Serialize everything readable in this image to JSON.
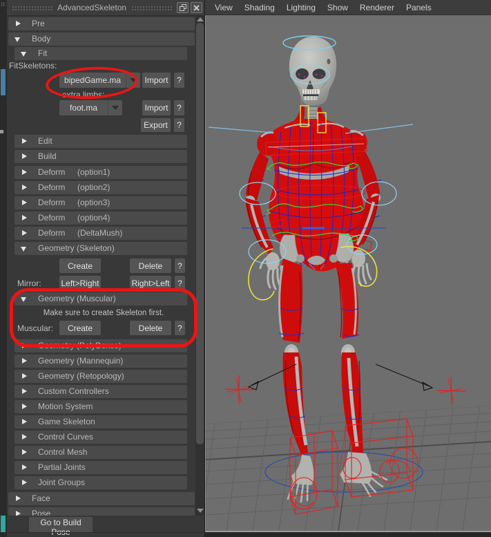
{
  "window": {
    "title": "AdvancedSkeleton"
  },
  "panel": {
    "help": "?",
    "sections": {
      "pre": "Pre",
      "body": "Body",
      "face": "Face",
      "pose": "Pose"
    },
    "fit": {
      "header": "Fit",
      "fitskeletons_label": "FitSkeletons:",
      "skeleton_file": "bipedGame.ma",
      "import_label": "Import",
      "extra_limbs_label": "extra limbs:",
      "limb_file": "foot.ma",
      "export_label": "Export"
    },
    "rows": [
      {
        "label": "Edit",
        "option": ""
      },
      {
        "label": "Build",
        "option": ""
      },
      {
        "label": "Deform",
        "option": "(option1)"
      },
      {
        "label": "Deform",
        "option": "(option2)"
      },
      {
        "label": "Deform",
        "option": "(option3)"
      },
      {
        "label": "Deform",
        "option": "(option4)"
      },
      {
        "label": "Deform",
        "option": "(DeltaMush)"
      }
    ],
    "geometry_skeleton": {
      "header": "Geometry (Skeleton)",
      "create": "Create",
      "delete": "Delete",
      "mirror_label": "Mirror:",
      "left_right": "Left>Right",
      "right_left": "Right>Left"
    },
    "geometry_muscular": {
      "header": "Geometry (Muscular)",
      "note": "Make sure to create Skeleton first.",
      "muscular_label": "Muscular:",
      "create": "Create",
      "delete": "Delete"
    },
    "collapsed": [
      "Geometry (PolyBoxes)",
      "Geometry (Mannequin)",
      "Geometry (Retopology)",
      "Custom Controllers",
      "Motion System",
      "Game Skeleton",
      "Control Curves",
      "Control Mesh",
      "Partial Joints",
      "Joint Groups"
    ],
    "footer_button": "Go to Build Pose"
  },
  "viewport": {
    "menu": [
      "View",
      "Shading",
      "Lighting",
      "Show",
      "Renderer",
      "Panels"
    ]
  },
  "colors": {
    "annotation_red": "#ea1515",
    "muscle_red": "#d30d0d",
    "bone_gray": "#b2b2af",
    "wireframe_blue": "#1c23c9",
    "control_cyan": "#7fd8f0",
    "control_yellow": "#f5e63a",
    "control_green": "#35d435",
    "ground_circle_blue": "#2f54a0",
    "viewport_bg": "#6e6e6e"
  }
}
